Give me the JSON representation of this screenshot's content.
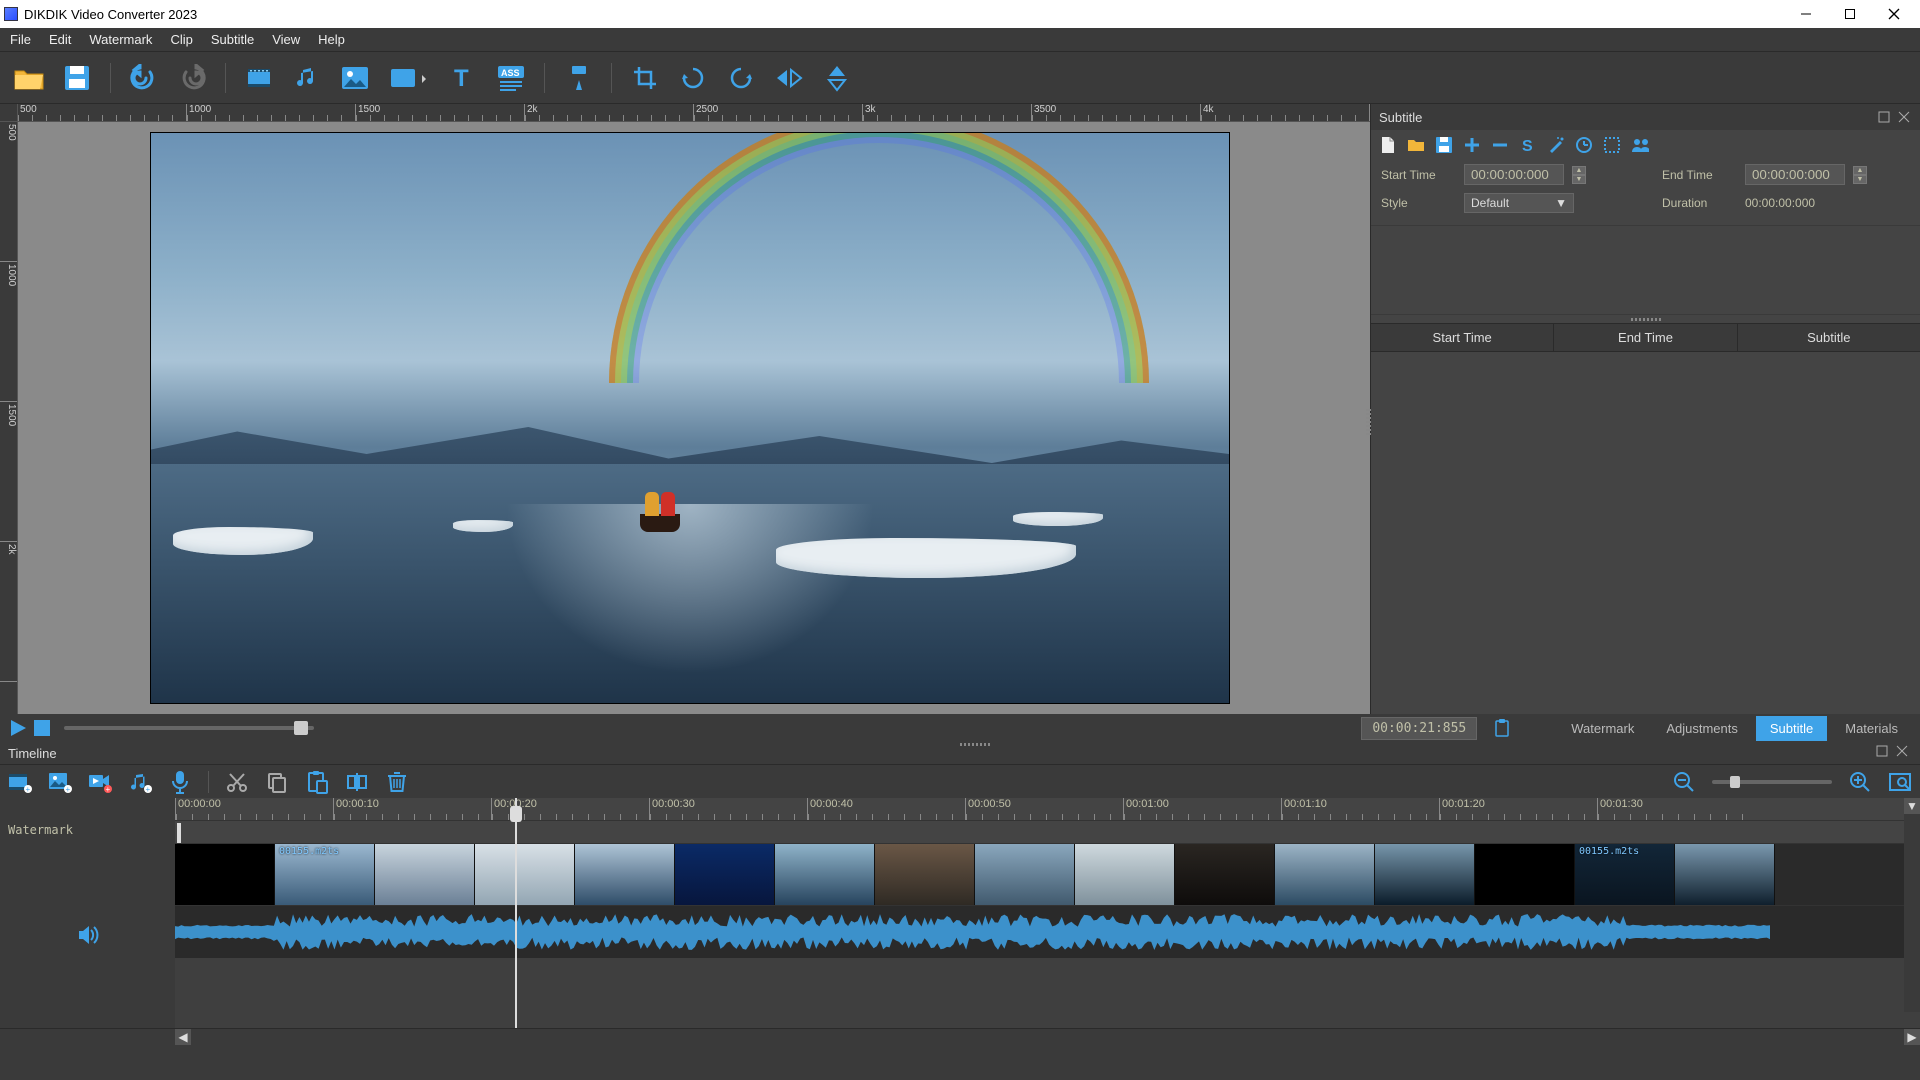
{
  "window": {
    "title": "DIKDIK Video Converter 2023"
  },
  "menu": {
    "items": [
      "File",
      "Edit",
      "Watermark",
      "Clip",
      "Subtitle",
      "View",
      "Help"
    ]
  },
  "toolbar": {
    "items": [
      "open-folder-icon",
      "save-icon",
      "undo-icon",
      "redo-icon",
      "film-icon",
      "music-icon",
      "image-icon",
      "rectangle-icon",
      "text-icon",
      "ass-subtitle-icon",
      "paint-format-icon",
      "crop-icon",
      "rotate-left-icon",
      "rotate-right-icon",
      "flip-h-icon",
      "flip-v-icon"
    ]
  },
  "preview": {
    "h_ruler_ticks": [
      "500",
      "",
      "1000",
      "",
      "1500",
      "",
      "2k",
      "",
      "2500",
      "",
      "3k",
      "",
      "3500",
      "",
      "4k"
    ],
    "v_ruler_ticks": [
      "500",
      "1000",
      "1500",
      "2k"
    ]
  },
  "transport": {
    "timecode": "00:00:21:855",
    "tabs": [
      "Watermark",
      "Adjustments",
      "Subtitle",
      "Materials"
    ],
    "active_tab": "Subtitle"
  },
  "subtitle_panel": {
    "title": "Subtitle",
    "start_label": "Start Time",
    "start_value": "00:00:00:000",
    "end_label": "End Time",
    "end_value": "00:00:00:000",
    "style_label": "Style",
    "style_value": "Default",
    "duration_label": "Duration",
    "duration_value": "00:00:00:000",
    "table_headers": [
      "Start Time",
      "End Time",
      "Subtitle"
    ],
    "icon_row": [
      "new-file-icon",
      "open-folder-icon",
      "save-icon",
      "add-icon",
      "remove-icon",
      "s-style-icon",
      "wand-icon",
      "clock-icon",
      "selection-icon",
      "group-icon"
    ]
  },
  "timeline": {
    "title": "Timeline",
    "label_watermark": "Watermark",
    "ruler": [
      "00:00:00",
      "00:00:10",
      "00:00:20",
      "00:00:30",
      "00:00:40",
      "00:00:50",
      "00:01:00",
      "00:01:10",
      "00:01:20",
      "00:01:30"
    ],
    "clip_name": "00155.m2ts",
    "toolbar_items": [
      "film-add-icon",
      "image-add-icon",
      "video-add-icon",
      "audio-add-icon",
      "mic-icon",
      "cut-icon",
      "copy-icon",
      "paste-icon",
      "split-icon",
      "delete-icon"
    ],
    "colors": {
      "accent": "#3fa3e8"
    },
    "thumbs": [
      "linear-gradient(180deg,#0e1824,#1a2a3a)",
      "linear-gradient(180deg,#9bb8d0,#3a5b78)",
      "linear-gradient(180deg,#c8d4dd,#6b8096)",
      "linear-gradient(180deg,#d8e0e6,#93a6b3)",
      "linear-gradient(180deg,#aec4d6,#2f4d69)",
      "linear-gradient(180deg,#0b2a66,#07163d)",
      "linear-gradient(180deg,#8fb3c9,#27445e)",
      "linear-gradient(180deg,#6a5746,#2f2a24)",
      "linear-gradient(180deg,#8aa7bd,#415a6e)",
      "linear-gradient(180deg,#cfd9de,#7f919c)",
      "linear-gradient(180deg,#2a2622,#0e0c0b)",
      "linear-gradient(180deg,#9cb4c6,#2c4b63)",
      "linear-gradient(180deg,#7796ab,#0b1c2a)",
      "linear-gradient(180deg,#0e1824,#1a2a3a)",
      "linear-gradient(180deg,#122638,#0a1520)",
      "linear-gradient(180deg,#7a98ae,#0f1f2d)"
    ]
  }
}
